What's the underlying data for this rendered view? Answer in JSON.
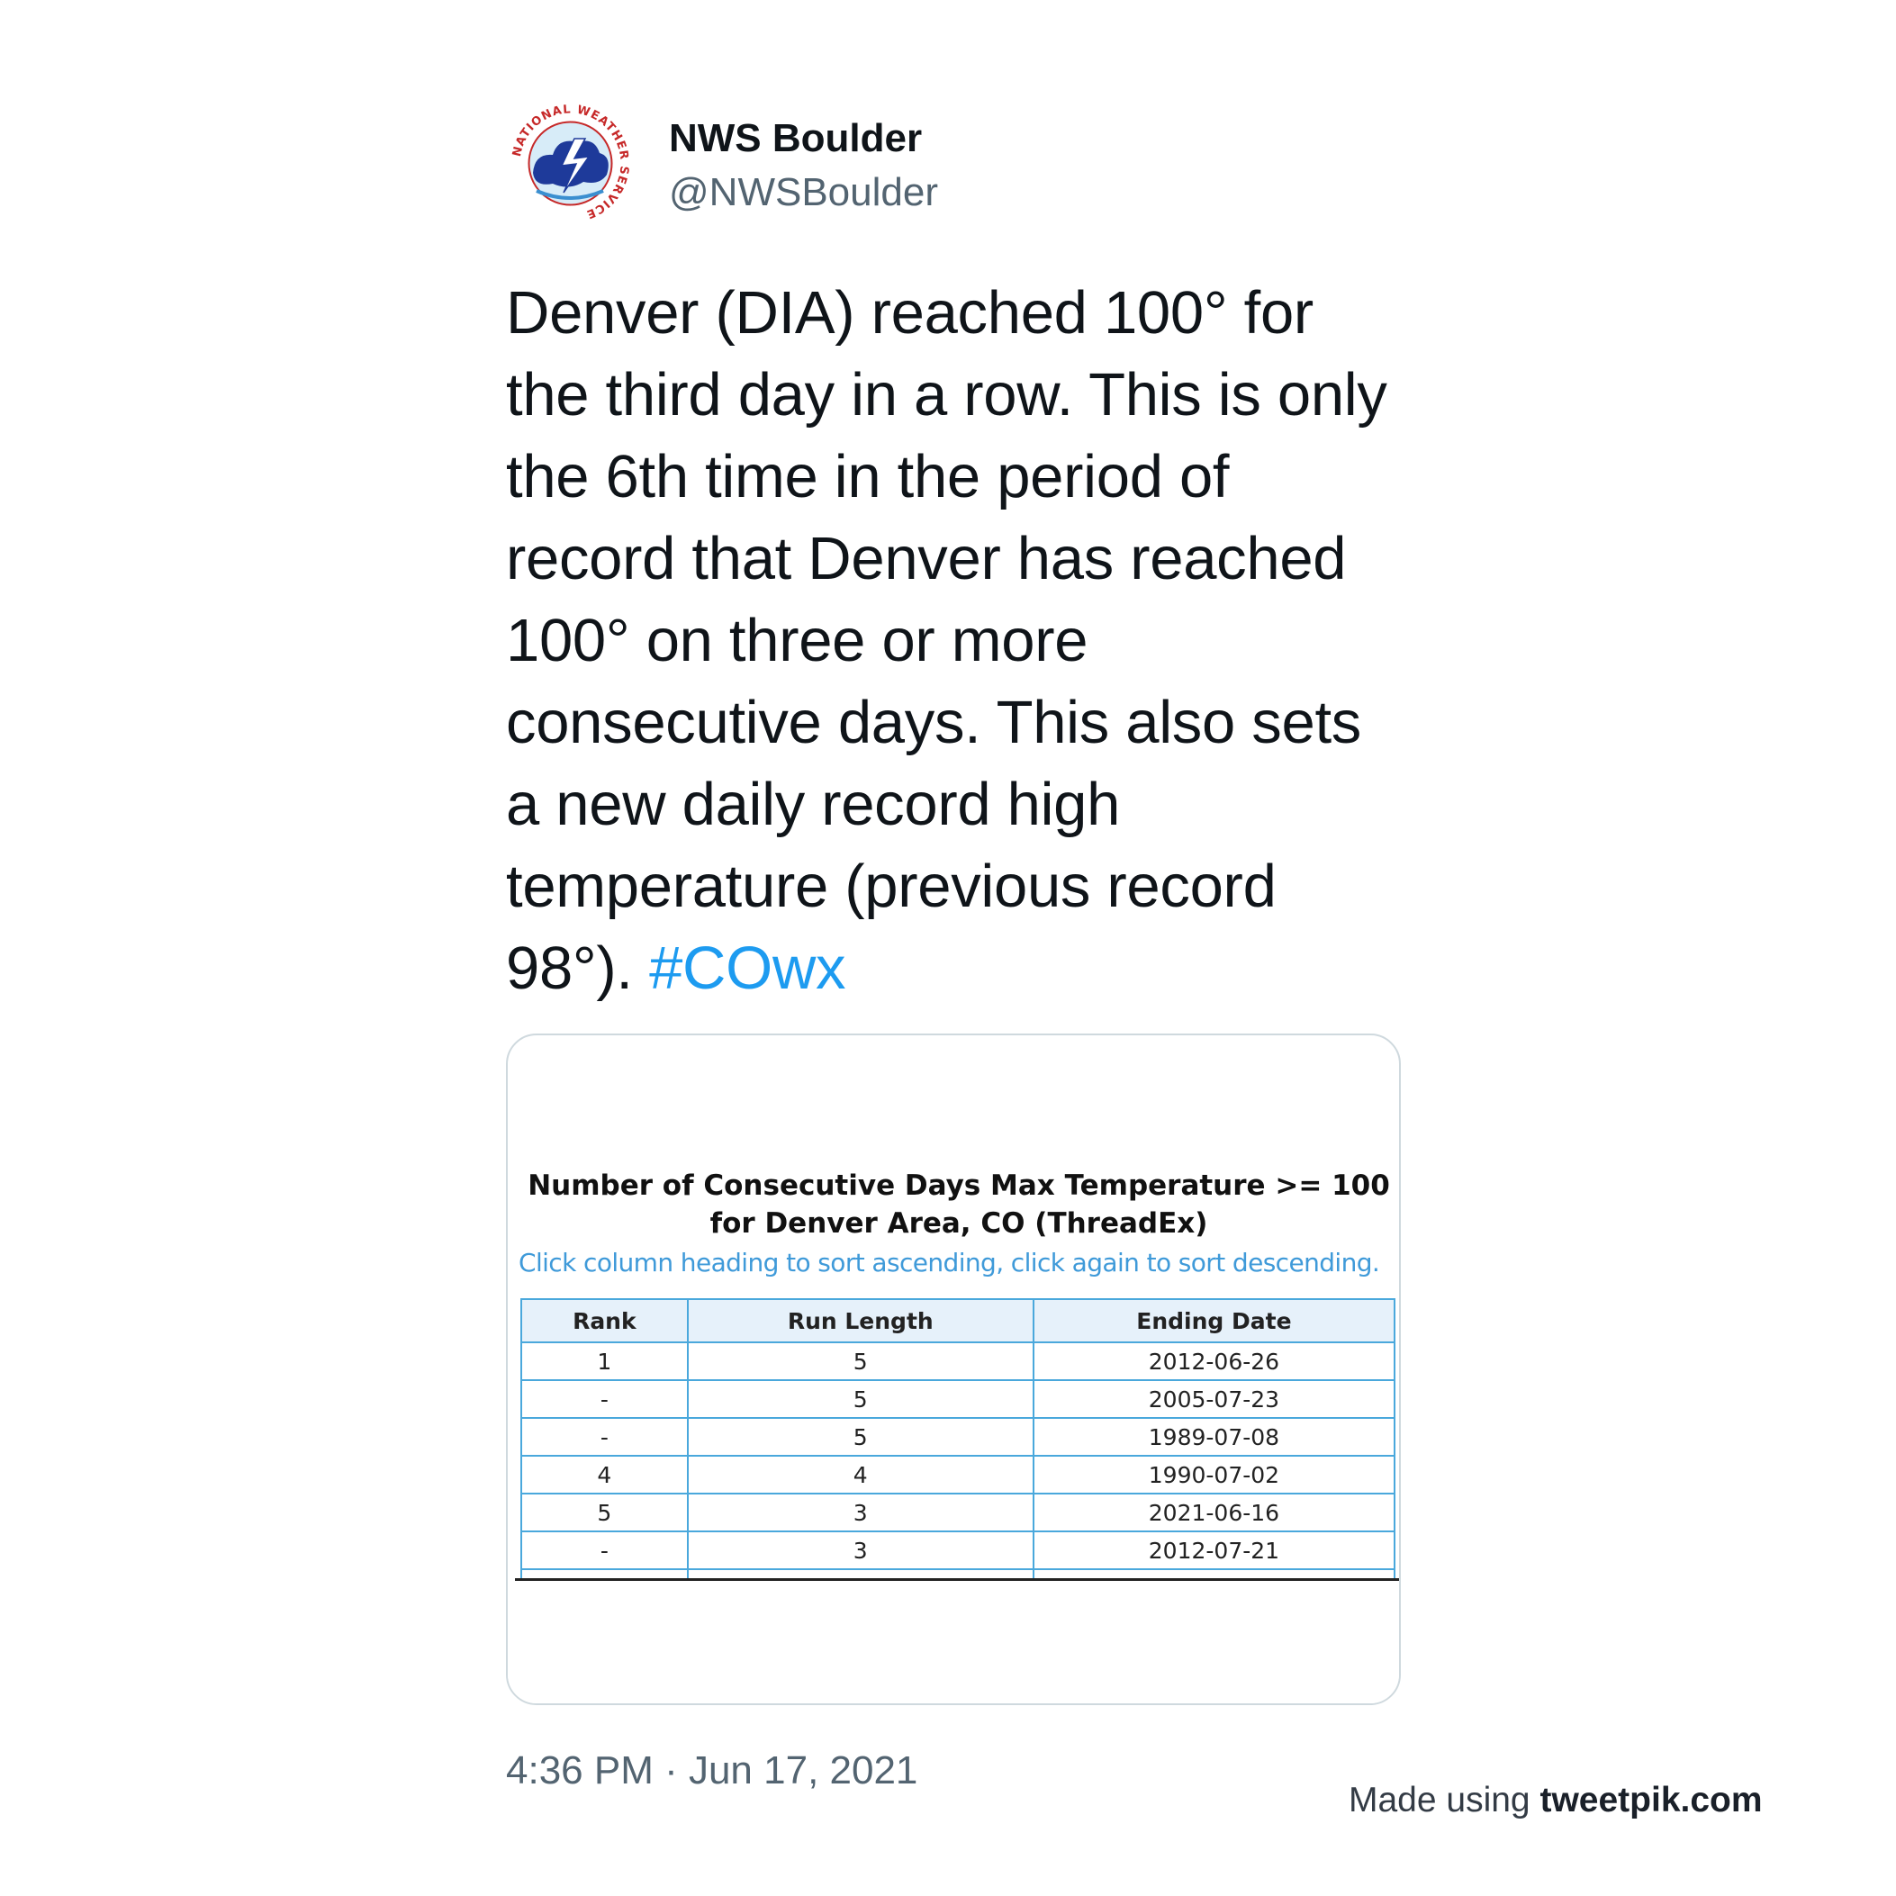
{
  "author": {
    "display_name": "NWS Boulder",
    "handle": "@NWSBoulder",
    "avatar": {
      "icon": "nws-logo-icon",
      "text": "NATIONAL WEATHER SERVICE"
    }
  },
  "tweet": {
    "lines": [
      "Denver (DIA) reached 100° for",
      "the third day in a row. This is only",
      "the 6th time in the period of",
      "record that Denver has reached",
      "100° on three or more",
      "consecutive days. This also sets",
      "a new daily record high",
      "temperature (previous record",
      "98°)."
    ],
    "hashtag": "#COwx",
    "timestamp": "4:36 PM · Jun 17, 2021"
  },
  "media": {
    "title_line1": "Number of Consecutive Days Max Temperature >= 100",
    "title_line2": "for Denver Area, CO (ThreadEx)",
    "note": "Click column heading to sort ascending, click again to sort descending.",
    "columns": [
      "Rank",
      "Run Length",
      "Ending Date"
    ],
    "rows": [
      [
        "1",
        "5",
        "2012-06-26"
      ],
      [
        "-",
        "5",
        "2005-07-23"
      ],
      [
        "-",
        "5",
        "1989-07-08"
      ],
      [
        "4",
        "4",
        "1990-07-02"
      ],
      [
        "5",
        "3",
        "2021-06-16"
      ],
      [
        "-",
        "3",
        "2012-07-21"
      ]
    ]
  },
  "footer": {
    "credit_prefix": "Made using ",
    "credit_brand": "tweetpik.com"
  },
  "colors": {
    "hashtag": "#1d9bf0",
    "table_border": "#4aa8dc",
    "note": "#3f9ad9"
  }
}
